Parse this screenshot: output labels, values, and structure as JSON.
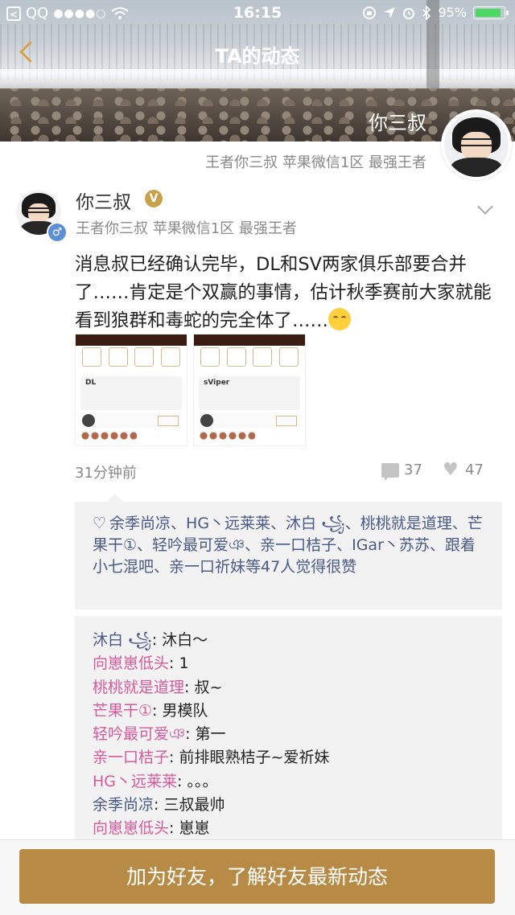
{
  "status_bar": {
    "back_glyph": "<",
    "carrier": "QQ",
    "signal": "●●●●○",
    "time": "16:15",
    "battery_percent": "95%",
    "battery_level": 0.95
  },
  "nav": {
    "title": "TA的动态"
  },
  "profile_header": {
    "name": "你三叔",
    "subtitle": "王者你三叔 苹果微信1区 最强王者"
  },
  "post": {
    "author": "你三叔",
    "verified_badge": "V",
    "gender_symbol": "♂",
    "author_sub": "王者你三叔 苹果微信1区 最强王者",
    "text": "消息叔已经确认完毕，DL和SV两家俱乐部要合并了……肯定是个双赢的事情，估计秋季赛前大家就能看到狼群和毒蛇的完全体了……",
    "images": [
      {
        "card_title": "DL"
      },
      {
        "card_title": "sViper"
      }
    ],
    "time": "31分钟前",
    "comment_count": "37",
    "like_count": "47"
  },
  "likes": {
    "heart_glyph": "♡",
    "text": "余季尚凉、HG丶远莱莱、沐白 ꧁、桃桃就是道理、芒果干①、轻吟最可爱ঞ、亲一口桔子、IGar丶苏苏、跟着小七混吧、亲一口祈妹等47人觉得很赞"
  },
  "comments": [
    {
      "author": "沐白 ꧁",
      "text": ": 沐白～",
      "pink": false
    },
    {
      "author": "向崽崽低头",
      "text": ": 1",
      "pink": true
    },
    {
      "author": "桃桃就是道理",
      "text": ": 叔~",
      "pink": true
    },
    {
      "author": "芒果干①",
      "text": ": 男模队",
      "pink": true
    },
    {
      "author": "轻吟最可爱ঞ",
      "text": ": 第一",
      "pink": true
    },
    {
      "author": "亲一口桔子",
      "text": ": 前排眼熟桔子~爱祈妹",
      "pink": true
    },
    {
      "author": "HG丶远莱莱",
      "text": ": 。。。",
      "pink": true
    },
    {
      "author": "余季尚凉",
      "text": ": 三叔最帅",
      "pink": false
    },
    {
      "author": "向崽崽低头",
      "text": ": 崽崽",
      "pink": true
    }
  ],
  "footer": {
    "button_label": "加为好友，了解好友最新动态"
  },
  "colors": {
    "accent_gold": "#b78b45",
    "link_blue": "#4a5a86",
    "link_pink": "#d55a9a",
    "battery_green": "#4cd964"
  },
  "icons": [
    "back-icon",
    "signal-icon",
    "wifi-icon",
    "lock-rotation-icon",
    "location-icon",
    "alarm-icon",
    "bluetooth-icon",
    "battery-icon",
    "nav-back-icon",
    "chevron-down-icon",
    "comment-icon",
    "like-icon",
    "heart-icon"
  ]
}
